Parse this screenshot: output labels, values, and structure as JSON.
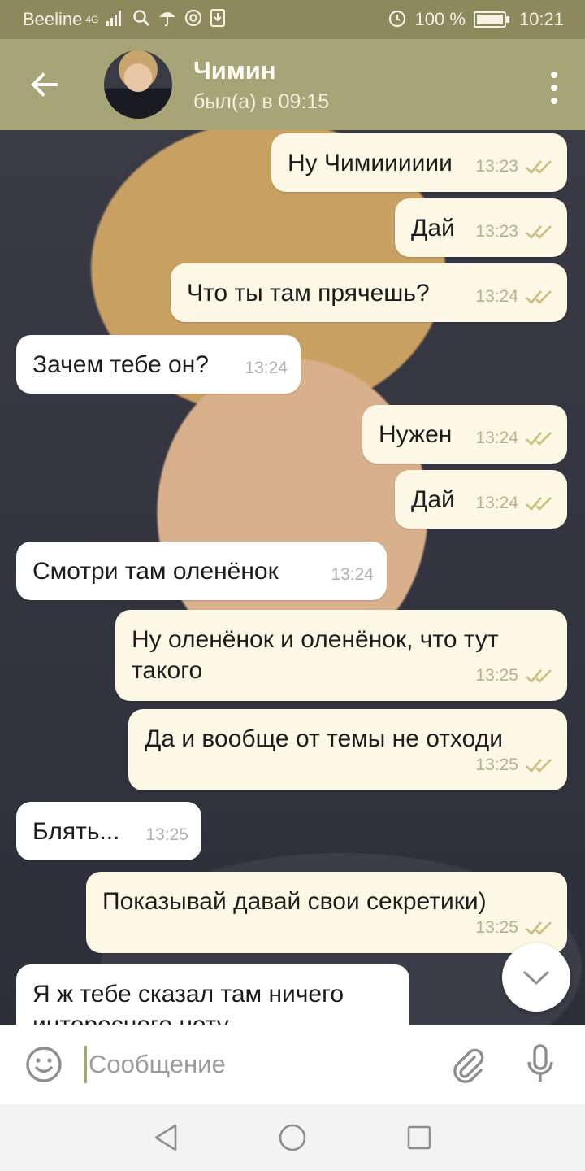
{
  "status": {
    "carrier": "Beeline",
    "network": "4G",
    "battery": "100 %",
    "battery_level": 1.0,
    "time": "10:21",
    "icons": [
      "signal-icon",
      "search-icon",
      "umbrella-icon",
      "at-icon",
      "download-icon",
      "alarm-icon",
      "battery-icon"
    ]
  },
  "header": {
    "back_icon": "arrow-left-icon",
    "contact_name": "Чимин",
    "last_seen": "был(а) в 09:15",
    "menu_icon": "more-vertical-icon"
  },
  "messages": [
    {
      "dir": "out",
      "text": "Ну Чимииииии",
      "time": "13:23"
    },
    {
      "dir": "out",
      "text": "Дай",
      "time": "13:23"
    },
    {
      "dir": "out",
      "text": "Что ты там прячешь?",
      "time": "13:24"
    },
    {
      "dir": "in",
      "text": "Зачем тебе он?",
      "time": "13:24"
    },
    {
      "dir": "out",
      "text": "Нужен",
      "time": "13:24"
    },
    {
      "dir": "out",
      "text": "Дай",
      "time": "13:24"
    },
    {
      "dir": "in",
      "text": "Смотри там оленёнок",
      "time": "13:24"
    },
    {
      "dir": "out",
      "text": "Ну оленёнок и оленёнок, что тут такого",
      "time": "13:25"
    },
    {
      "dir": "out",
      "text": "Да и вообще от темы не отходи",
      "time": "13:25"
    },
    {
      "dir": "in",
      "text": "Блять...",
      "time": "13:25"
    },
    {
      "dir": "out",
      "text": "Показывай давай свои секретики)",
      "time": "13:25"
    },
    {
      "dir": "in",
      "text": "Я ж тебе сказал там ничего интересного нету",
      "time": ""
    }
  ],
  "composer": {
    "placeholder": "Сообщение",
    "emoji_icon": "emoji-icon",
    "attach_icon": "paperclip-icon",
    "mic_icon": "microphone-icon"
  },
  "scroll_icon": "chevron-down-icon",
  "nav": [
    "back-triangle-icon",
    "home-circle-icon",
    "recents-square-icon"
  ],
  "colors": {
    "accent": "#a7a477",
    "status_bar": "#8c8a5c",
    "bubble_out": "#fdf8e6",
    "bubble_in": "#ffffff",
    "check": "#c9bf7a"
  }
}
